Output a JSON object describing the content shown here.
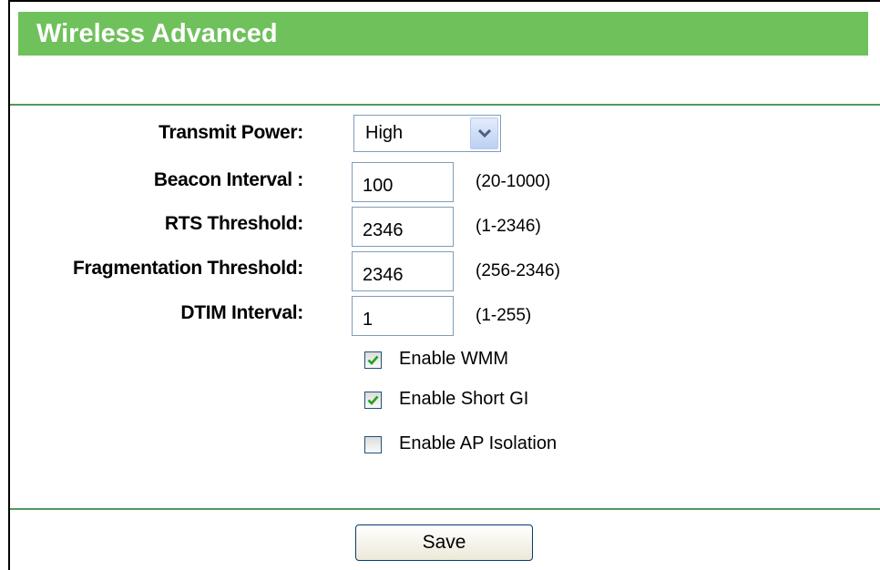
{
  "header": {
    "title": "Wireless Advanced"
  },
  "fields": {
    "transmit_power": {
      "label": "Transmit Power:",
      "value": "High"
    },
    "beacon_interval": {
      "label": "Beacon Interval :",
      "value": "100",
      "hint": "(20-1000)"
    },
    "rts_threshold": {
      "label": "RTS Threshold:",
      "value": "2346",
      "hint": "(1-2346)"
    },
    "fragmentation_threshold": {
      "label": "Fragmentation Threshold:",
      "value": "2346",
      "hint": "(256-2346)"
    },
    "dtim_interval": {
      "label": "DTIM Interval:",
      "value": "1",
      "hint": "(1-255)"
    }
  },
  "checkboxes": {
    "wmm": {
      "label": "Enable WMM",
      "checked": true
    },
    "short_gi": {
      "label": "Enable Short GI",
      "checked": true
    },
    "ap_isolation": {
      "label": "Enable AP Isolation",
      "checked": false
    }
  },
  "actions": {
    "save_label": "Save"
  },
  "colors": {
    "header_bg": "#6fc15b",
    "divider": "#4e9a63",
    "check_mark": "#21a121"
  }
}
